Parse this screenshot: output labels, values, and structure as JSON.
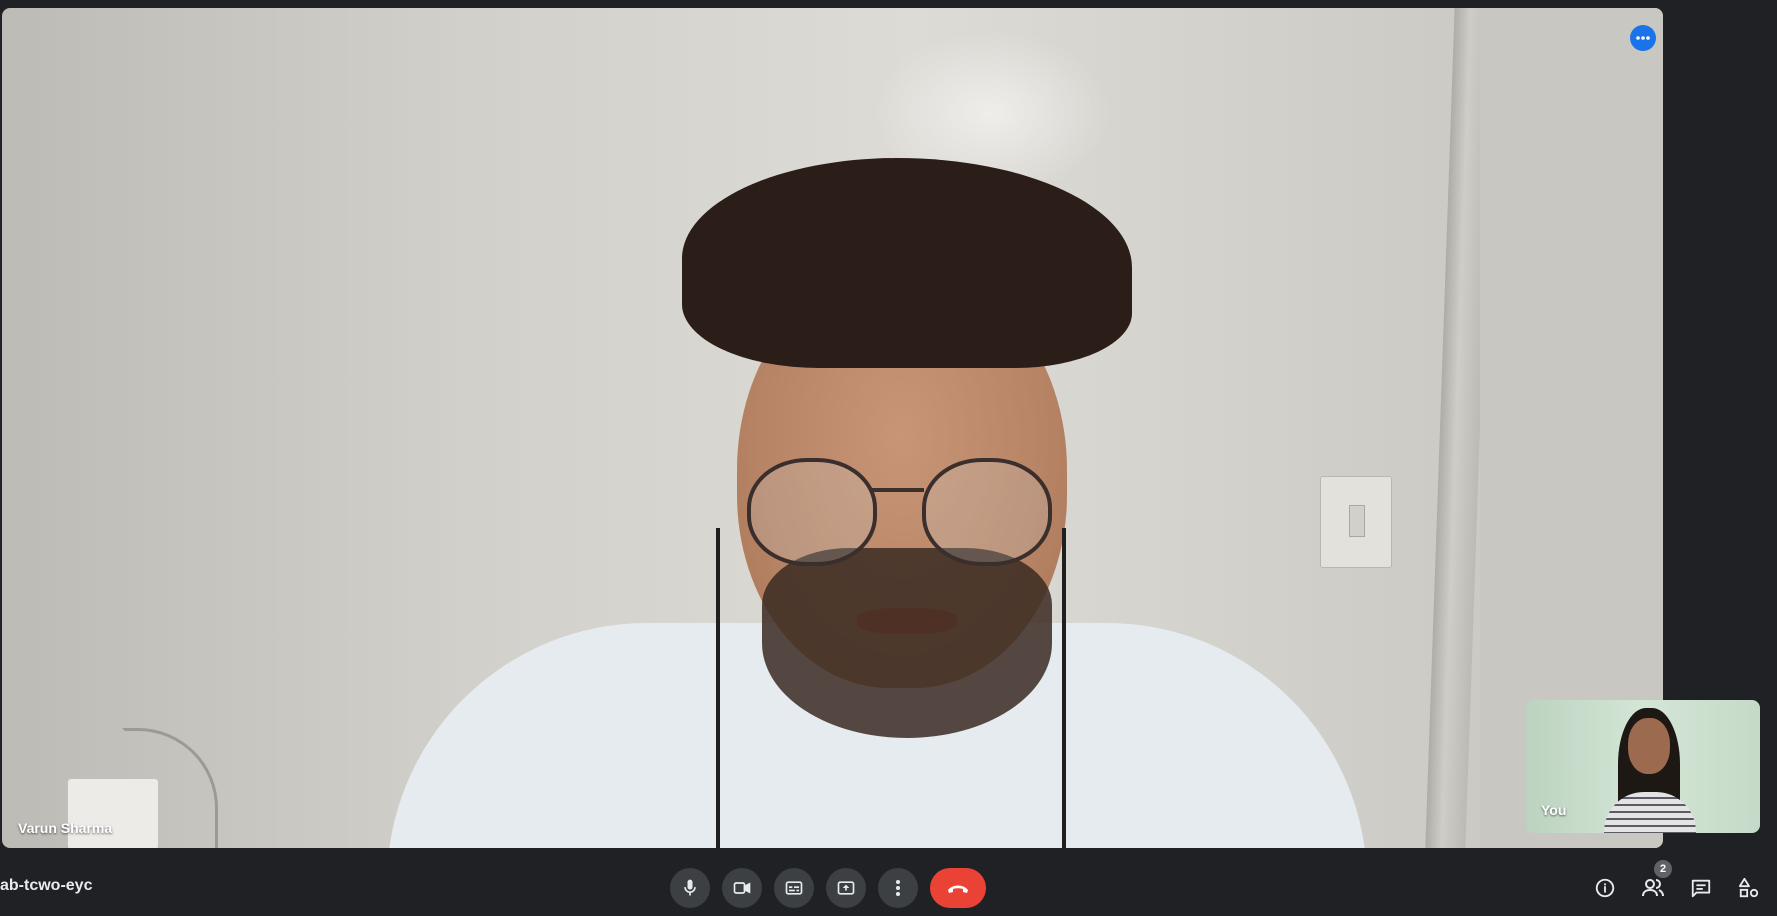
{
  "main_tile": {
    "participant_name": "Varun Sharma",
    "more_options_icon": "more-horiz-icon"
  },
  "self_view": {
    "label": "You"
  },
  "bottom_bar": {
    "meeting_code": "ab-tcwo-eyc",
    "controls": [
      {
        "name": "microphone",
        "icon": "mic-icon"
      },
      {
        "name": "camera",
        "icon": "videocam-icon"
      },
      {
        "name": "captions",
        "icon": "closed-caption-icon"
      },
      {
        "name": "present",
        "icon": "present-to-all-icon"
      },
      {
        "name": "more-options",
        "icon": "more-vert-icon"
      },
      {
        "name": "leave-call",
        "icon": "call-end-icon"
      }
    ],
    "side_controls": [
      {
        "name": "meeting-details",
        "icon": "info-icon"
      },
      {
        "name": "people",
        "icon": "people-icon",
        "count": "2"
      },
      {
        "name": "chat",
        "icon": "chat-icon"
      },
      {
        "name": "activities",
        "icon": "shapes-icon"
      }
    ]
  },
  "colors": {
    "background": "#202124",
    "control_button": "#3c4043",
    "leave_button": "#ea4335",
    "accent": "#1a73e8"
  }
}
